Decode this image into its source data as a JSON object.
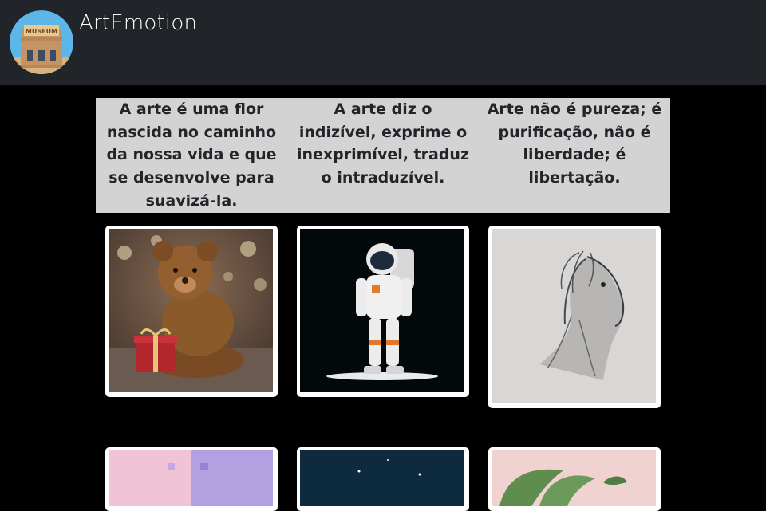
{
  "header": {
    "brand": "ArtEmotion",
    "logo_icon": "museum-building-icon",
    "logo_text": "MUSEUM"
  },
  "quotes": [
    "A arte é uma flor nascida no caminho da nossa vida e que se desenvolve para suavizá-la.",
    "A arte diz o indizível, exprime o inexprimível, traduz o intraduzível.",
    "Arte não é pureza; é purificação, não é liberdade; é libertação."
  ],
  "gallery": {
    "row1": [
      {
        "subject": "teddy-bear-with-gift"
      },
      {
        "subject": "astronaut"
      },
      {
        "subject": "horse-sketch"
      }
    ],
    "row2": [
      {
        "subject": "pastel-abstract"
      },
      {
        "subject": "night-sky"
      },
      {
        "subject": "green-leaves"
      }
    ]
  },
  "colors": {
    "header_bg": "#212529",
    "page_bg": "#000000",
    "quote_bg": "#d3d3d3",
    "card_bg": "#ffffff"
  }
}
